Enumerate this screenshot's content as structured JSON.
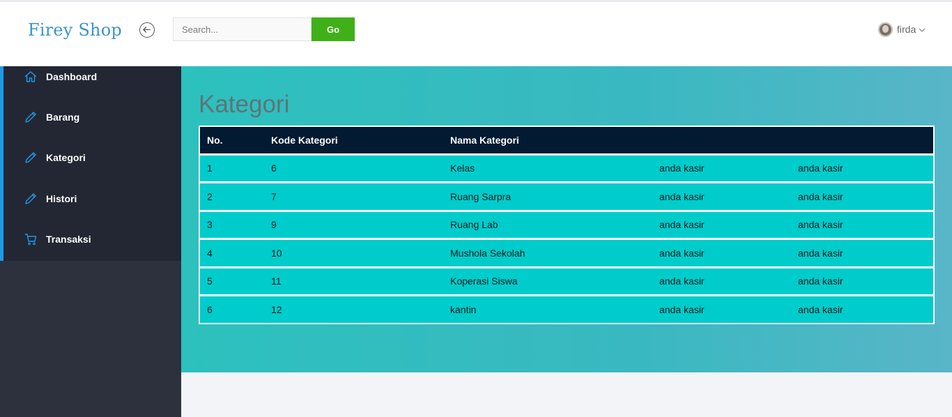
{
  "app": {
    "brand": "Firey Shop"
  },
  "search": {
    "placeholder": "Search...",
    "value": "",
    "button_label": "Go"
  },
  "user": {
    "name": "firda"
  },
  "sidebar": {
    "items": [
      {
        "label": "Dashboard",
        "icon": "home-icon"
      },
      {
        "label": "Barang",
        "icon": "pencil-icon"
      },
      {
        "label": "Kategori",
        "icon": "pencil-icon"
      },
      {
        "label": "Histori",
        "icon": "pencil-icon"
      },
      {
        "label": "Transaksi",
        "icon": "cart-icon"
      }
    ]
  },
  "main": {
    "title": "Kategori",
    "table": {
      "headers": [
        "No.",
        "Kode Kategori",
        "Nama Kategori",
        "",
        ""
      ],
      "rows": [
        [
          "1",
          "6",
          "Kelas",
          "anda kasir",
          "anda kasir"
        ],
        [
          "2",
          "7",
          "Ruang Sarpra",
          "anda kasir",
          "anda kasir"
        ],
        [
          "3",
          "9",
          "Ruang Lab",
          "anda kasir",
          "anda kasir"
        ],
        [
          "4",
          "10",
          "Mushola Sekolah",
          "anda kasir",
          "anda kasir"
        ],
        [
          "5",
          "11",
          "Koperasi Siswa",
          "anda kasir",
          "anda kasir"
        ],
        [
          "6",
          "12",
          "kantin",
          "anda kasir",
          "anda kasir"
        ]
      ]
    }
  },
  "colors": {
    "brand": "#3a95c9",
    "go_button": "#40b018",
    "sidebar_bg": "#222733",
    "sidebar_accent": "#1e9aea",
    "table_header": "#021a32",
    "table_row": "#00cccc"
  }
}
